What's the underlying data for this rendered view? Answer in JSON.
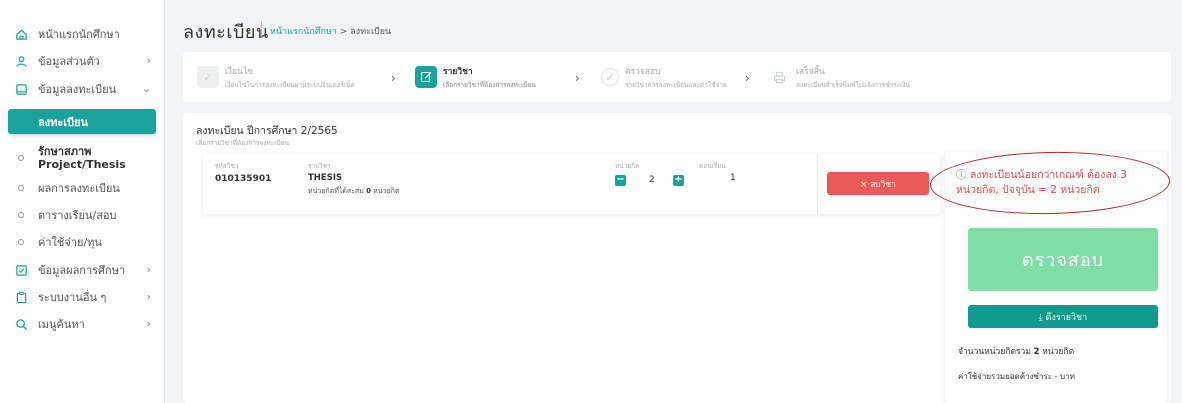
{
  "sidebar": {
    "items": [
      {
        "label": "หน้าแรกนักศึกษา",
        "icon": "home-icon"
      },
      {
        "label": "ข้อมูลส่วนตัว",
        "icon": "user-icon"
      },
      {
        "label": "ข้อมูลลงทะเบียน",
        "icon": "register-icon"
      },
      {
        "label": "ข้อมูลผลการศึกษา",
        "icon": "checklist-icon"
      },
      {
        "label": "ระบบงานอื่น ๆ",
        "icon": "clipboard-icon"
      },
      {
        "label": "เมนูค้นหา",
        "icon": "search-icon"
      }
    ],
    "active": "ลงทะเบียน",
    "subitems": [
      {
        "label": "รักษาสภาพ Project/Thesis"
      },
      {
        "label": "ผลการลงทะเบียน"
      },
      {
        "label": "ตารางเรียน/สอบ"
      },
      {
        "label": "ค่าใช้จ่าย/ทุน"
      }
    ]
  },
  "header": {
    "title": "ลงทะเบียน",
    "breadcrumb_home": "หน้าแรกนักศึกษา",
    "breadcrumb_sep": ">",
    "breadcrumb_current": "ลงทะเบียน"
  },
  "steps": [
    {
      "title": "เงื่อนไข",
      "desc": "เงื่อนไขในการลงทะเบียนผ่านระบบอินเตอร์เน็ต",
      "state": "done"
    },
    {
      "title": "รายวิชา",
      "desc": "เลือกรายวิชาที่ต้องการลงทะเบียน",
      "state": "active"
    },
    {
      "title": "ตรวจสอบ",
      "desc": "รายวิชาการลงทะเบียนและค่าใช้จ่าย",
      "state": "pending"
    },
    {
      "title": "เสร็จสิ้น",
      "desc": "ลงทะเบียนสำเร็จพิมพ์ใบแจ้งการชำระเงิน",
      "state": "pending"
    }
  ],
  "registration": {
    "title": "ลงทะเบียน ปีการศึกษา 2/2565",
    "subtitle": "เลือกรายวิชาที่ต้องการลงทะเบียน",
    "headers": {
      "code": "รหัสวิชา",
      "name": "รายวิชา",
      "units": "หน่วยกิต",
      "section": "ตอนเรียน"
    },
    "course": {
      "code": "010135901",
      "name": "THESIS",
      "note_prefix": "หน่วยกิตที่ได้สะสม",
      "note_value": "0",
      "note_suffix": "หน่วยกิต",
      "units": "2",
      "section": "1",
      "drop_label": "× ลบวิชา"
    }
  },
  "panel": {
    "warning": "ⓘ ลงทะเบียนน้อยกว่าเกณฑ์ ต้องลง 3 หน่วยกิต, ปัจจุบัน = 2 หน่วยกิต",
    "check_label": "ตรวจสอบ",
    "pull_label": "⤓ ดึงรายวิชา",
    "total_prefix": "จำนวนหน่วยกิตรวม",
    "total_value": "2",
    "total_suffix": "หน่วยกิต",
    "cost_text": "ค่าใช้จ่ายรวมยอดค้างชำระ - บาท"
  },
  "colors": {
    "accent": "#1aa39a",
    "danger": "#e95a5a",
    "check": "#7edea5",
    "warning_text": "#e24b4b"
  }
}
